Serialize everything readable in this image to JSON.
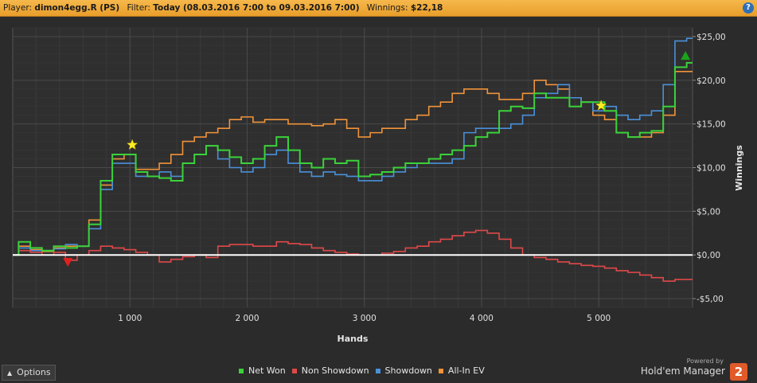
{
  "header": {
    "player_label": "Player:",
    "player_value": "dimon4egg.R (PS)",
    "filter_label": "Filter:",
    "filter_value": "Today (08.03.2016 7:00 to 09.03.2016 7:00)",
    "winnings_label": "Winnings:",
    "winnings_value": "$22,18",
    "help_glyph": "?"
  },
  "footer": {
    "options_label": "Options",
    "powered_by": "Powered by",
    "brand": "Hold'em Manager",
    "brand_mark": "2"
  },
  "chart_data": {
    "type": "line",
    "xlabel": "Hands",
    "ylabel": "Winnings",
    "xlim": [
      0,
      5800
    ],
    "ylim": [
      -6,
      26
    ],
    "x_ticks": [
      1000,
      2000,
      3000,
      4000,
      5000
    ],
    "x_tick_labels": [
      "1 000",
      "2 000",
      "3 000",
      "4 000",
      "5 000"
    ],
    "y_ticks": [
      -5,
      0,
      5,
      10,
      15,
      20,
      25
    ],
    "y_tick_labels": [
      "-$5,00",
      "$0,00",
      "$5,00",
      "$10,00",
      "$15,00",
      "$20,00",
      "$25,00"
    ],
    "grid": true,
    "legend_position": "bottom-center",
    "zero_line": true,
    "x": [
      0,
      100,
      200,
      300,
      400,
      500,
      600,
      700,
      800,
      900,
      1000,
      1100,
      1200,
      1300,
      1400,
      1500,
      1600,
      1700,
      1800,
      1900,
      2000,
      2100,
      2200,
      2300,
      2400,
      2500,
      2600,
      2700,
      2800,
      2900,
      3000,
      3100,
      3200,
      3300,
      3400,
      3500,
      3600,
      3700,
      3800,
      3900,
      4000,
      4100,
      4200,
      4300,
      4400,
      4500,
      4600,
      4700,
      4800,
      4900,
      5000,
      5100,
      5200,
      5300,
      5400,
      5500,
      5600,
      5700,
      5800
    ],
    "series": [
      {
        "name": "Net Won",
        "color": "#3ad23a",
        "values": [
          0,
          1.5,
          0.8,
          0.5,
          1.0,
          0.8,
          1.0,
          3.5,
          8.5,
          11.5,
          11.5,
          9.5,
          9.0,
          8.8,
          8.5,
          10.5,
          11.5,
          12.5,
          12.0,
          11.2,
          10.5,
          11.0,
          12.5,
          13.5,
          12.0,
          10.5,
          10.0,
          11.0,
          10.5,
          10.8,
          9.0,
          9.2,
          9.5,
          10.0,
          10.5,
          10.5,
          11.0,
          11.5,
          12.0,
          12.5,
          13.5,
          14.0,
          16.5,
          17.0,
          16.8,
          18.5,
          18.0,
          18.0,
          17.0,
          17.5,
          17.5,
          16.5,
          14.0,
          13.5,
          14.0,
          14.2,
          17.0,
          21.5,
          22.0
        ]
      },
      {
        "name": "Non Showdown",
        "color": "#e04848",
        "values": [
          0,
          0.5,
          0.3,
          0.0,
          0.3,
          -0.6,
          0.0,
          0.5,
          1.0,
          0.8,
          0.6,
          0.3,
          0.0,
          -0.8,
          -0.5,
          -0.2,
          0.0,
          -0.3,
          1.0,
          1.2,
          1.2,
          1.0,
          1.0,
          1.5,
          1.3,
          1.2,
          0.8,
          0.5,
          0.3,
          0.1,
          0.0,
          0.0,
          0.2,
          0.4,
          0.8,
          1.0,
          1.5,
          1.8,
          2.2,
          2.6,
          2.8,
          2.5,
          1.8,
          0.8,
          0.0,
          -0.3,
          -0.5,
          -0.8,
          -1.0,
          -1.2,
          -1.3,
          -1.5,
          -1.8,
          -2.0,
          -2.3,
          -2.6,
          -3.0,
          -2.8,
          -2.8
        ]
      },
      {
        "name": "Showdown",
        "color": "#4a90d9",
        "values": [
          0,
          0.8,
          0.5,
          0.5,
          0.7,
          1.2,
          1.0,
          3.0,
          7.5,
          10.5,
          10.5,
          9.0,
          9.0,
          9.5,
          9.0,
          10.5,
          11.5,
          12.5,
          11.0,
          10.0,
          9.5,
          10.0,
          11.5,
          12.0,
          10.5,
          9.5,
          9.0,
          9.5,
          9.2,
          9.0,
          8.5,
          8.5,
          9.0,
          9.5,
          10.0,
          10.5,
          10.5,
          10.5,
          11.0,
          14.0,
          14.5,
          14.5,
          14.5,
          15.0,
          16.0,
          18.0,
          18.5,
          19.5,
          18.0,
          17.5,
          16.5,
          17.0,
          16.0,
          15.5,
          16.0,
          16.5,
          19.5,
          24.5,
          24.8
        ]
      },
      {
        "name": "All-In EV",
        "color": "#f0933a",
        "values": [
          0,
          1.0,
          0.6,
          0.4,
          0.8,
          1.0,
          1.0,
          4.0,
          8.0,
          11.0,
          11.5,
          9.8,
          9.8,
          10.5,
          11.5,
          13.0,
          13.5,
          14.0,
          14.5,
          15.5,
          15.8,
          15.2,
          15.5,
          15.5,
          15.0,
          15.0,
          14.8,
          15.0,
          15.5,
          14.5,
          13.5,
          14.0,
          14.5,
          14.5,
          15.5,
          16.0,
          17.0,
          17.5,
          18.5,
          19.0,
          19.0,
          18.5,
          17.8,
          17.8,
          18.5,
          20.0,
          19.5,
          19.0,
          18.0,
          17.5,
          16.0,
          15.5,
          14.0,
          13.5,
          13.5,
          14.0,
          16.0,
          21.0,
          21.0
        ]
      }
    ],
    "markers": [
      {
        "name": "Net Won peak",
        "shape": "star",
        "color": "#ffee22",
        "x": 1020,
        "y": 12.6
      },
      {
        "name": "Non Showdown low",
        "shape": "triangle-down",
        "color": "#e02020",
        "x": 470,
        "y": -0.8
      },
      {
        "name": "Late peak",
        "shape": "star",
        "color": "#ffee22",
        "x": 5020,
        "y": 17.1
      },
      {
        "name": "Showdown high",
        "shape": "triangle-up",
        "color": "#1aa31a",
        "x": 5740,
        "y": 22.8
      }
    ]
  }
}
